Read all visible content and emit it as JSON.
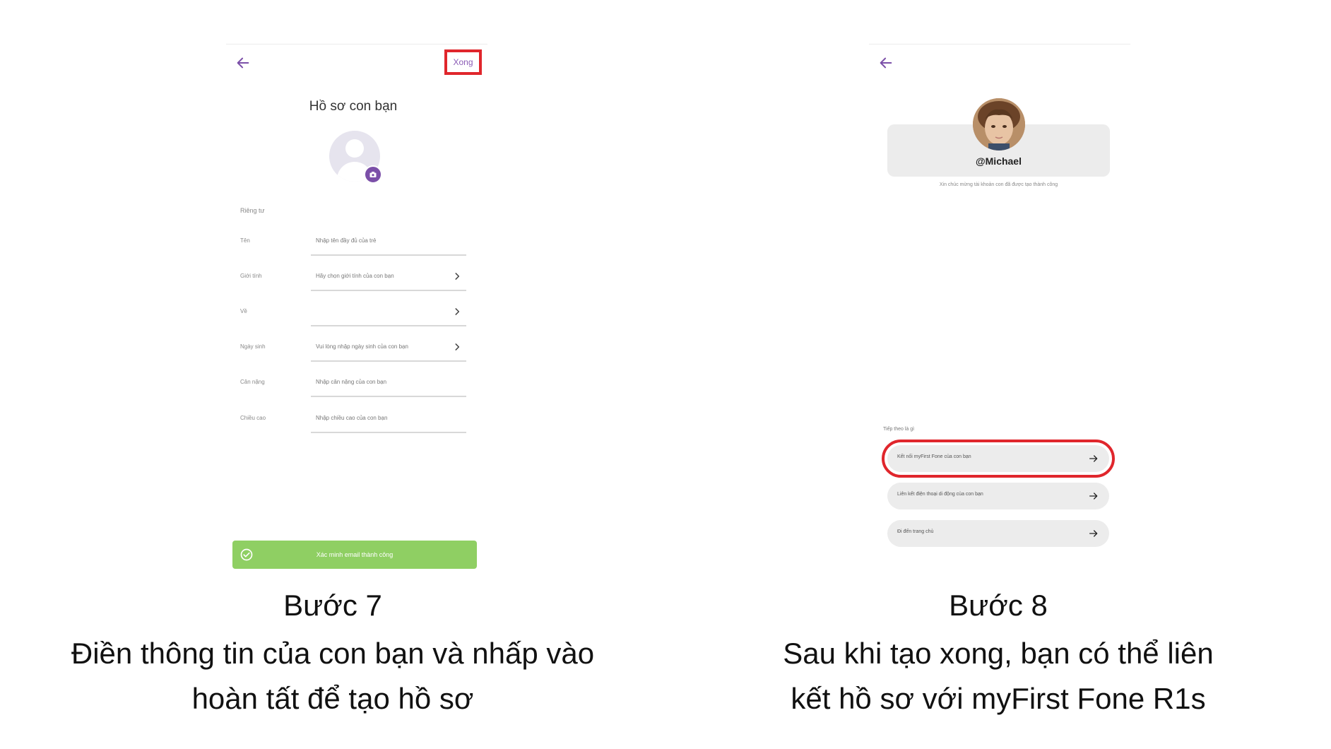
{
  "step7": {
    "done_label": "Xong",
    "title": "Hồ sơ con bạn",
    "section_label": "Riêng tư",
    "fields": [
      {
        "label": "Tên",
        "placeholder": "Nhập tên đầy đủ của trẻ"
      },
      {
        "label": "Giới tính",
        "placeholder": "Hãy chọn giới tính của con bạn"
      },
      {
        "label": "Về",
        "placeholder": ""
      },
      {
        "label": "Ngày sinh",
        "placeholder": "Vui lòng nhập ngày sinh của con bạn"
      },
      {
        "label": "Cân nặng",
        "placeholder": "Nhập cân nặng của con bạn"
      },
      {
        "label": "Chiều cao",
        "placeholder": "Nhập chiều cao của con bạn"
      }
    ],
    "success_message": "Xác minh email thành công",
    "caption_step": "Bước 7",
    "caption_line1": "Điền thông tin của con bạn và nhấp vào",
    "caption_line2": "hoàn tất để tạo hồ sơ"
  },
  "step8": {
    "username": "@Michael",
    "success_note": "Xin chúc mừng tài khoản con đã được tạo thành công",
    "next_label": "Tiếp theo là gì",
    "actions": [
      {
        "label": "Kết nối myFirst Fone của con bạn"
      },
      {
        "label": "Liên kết điện thoại di động của con bạn"
      },
      {
        "label": "Đi đến trang chủ"
      }
    ],
    "caption_step": "Bước 8",
    "caption_line1": "Sau khi tạo xong, bạn có thể liên",
    "caption_line2": "kết hồ sơ với myFirst Fone R1s"
  },
  "colors": {
    "accent": "#7b4fa8",
    "highlight": "#e0262c",
    "success": "#8fcf63"
  },
  "icons": [
    "back-arrow-icon",
    "camera-icon",
    "chevron-right-icon",
    "check-circle-icon",
    "arrow-right-icon",
    "user-placeholder-icon"
  ]
}
